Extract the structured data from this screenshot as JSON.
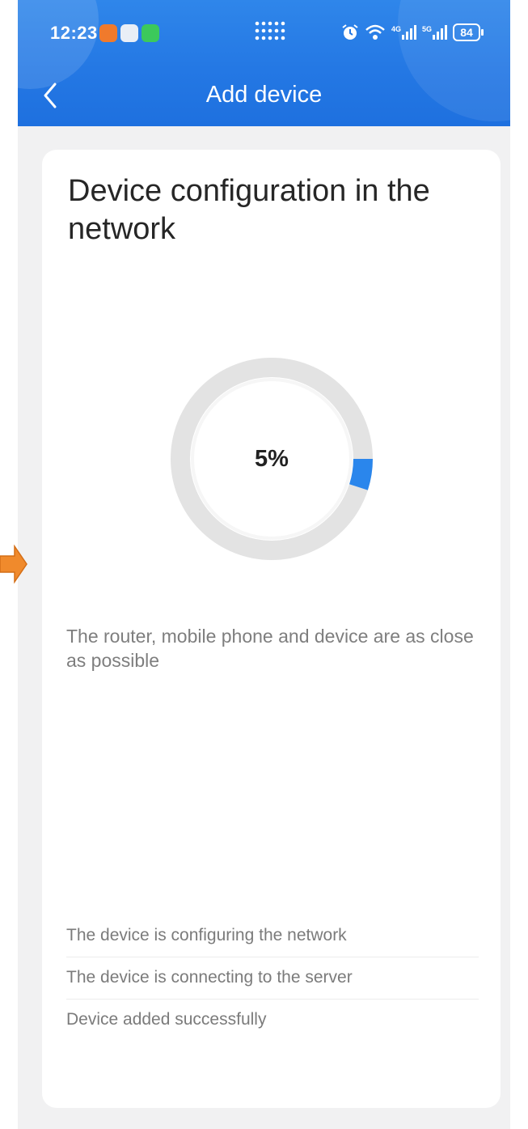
{
  "status_bar": {
    "time": "12:23",
    "battery": "84",
    "network_4g": "4G",
    "network_5g": "5G"
  },
  "nav": {
    "title": "Add device",
    "back_icon": "chevron-left-icon"
  },
  "card": {
    "title": "Device configuration in the network",
    "progress": {
      "percent_label": "5%",
      "value_percent": 5,
      "track_color": "#e3e3e3",
      "fill_color": "#2a86ec"
    },
    "tip": "The router, mobile phone and device are as close as possible",
    "steps": [
      "The device is configuring the network",
      "The device is connecting to the server",
      "Device added successfully"
    ]
  },
  "colors": {
    "header_blue": "#2478e4",
    "background": "#f1f1f2",
    "annotation_arrow": "#f08a2c"
  }
}
